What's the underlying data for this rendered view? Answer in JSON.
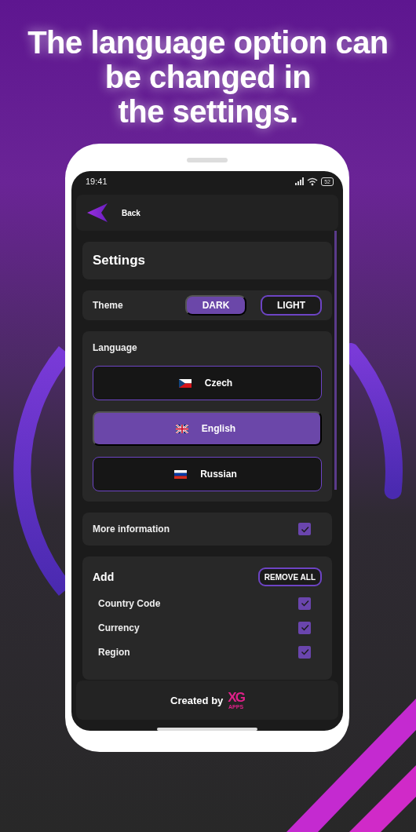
{
  "headline": {
    "lines": [
      "The language option can",
      "be changed in",
      "the settings."
    ]
  },
  "status_bar": {
    "time": "19:41",
    "battery": "52"
  },
  "back": {
    "label": "Back"
  },
  "title": "Settings",
  "theme": {
    "label": "Theme",
    "options": [
      {
        "label": "DARK",
        "selected": true
      },
      {
        "label": "LIGHT",
        "selected": false
      }
    ]
  },
  "language": {
    "label": "Language",
    "options": [
      {
        "label": "Czech",
        "kind": "cz",
        "selected": false
      },
      {
        "label": "English",
        "kind": "gb",
        "selected": true
      },
      {
        "label": "Russian",
        "kind": "ru",
        "selected": false
      }
    ]
  },
  "more_info": {
    "label": "More information",
    "checked": true
  },
  "add": {
    "label": "Add",
    "button": "REMOVE ALL",
    "items": [
      {
        "label": "Country Code",
        "checked": true
      },
      {
        "label": "Currency",
        "checked": true
      },
      {
        "label": "Region",
        "checked": true
      }
    ]
  },
  "footer": {
    "text": "Created by",
    "logo": "XG",
    "logo_sub": "APPS"
  }
}
